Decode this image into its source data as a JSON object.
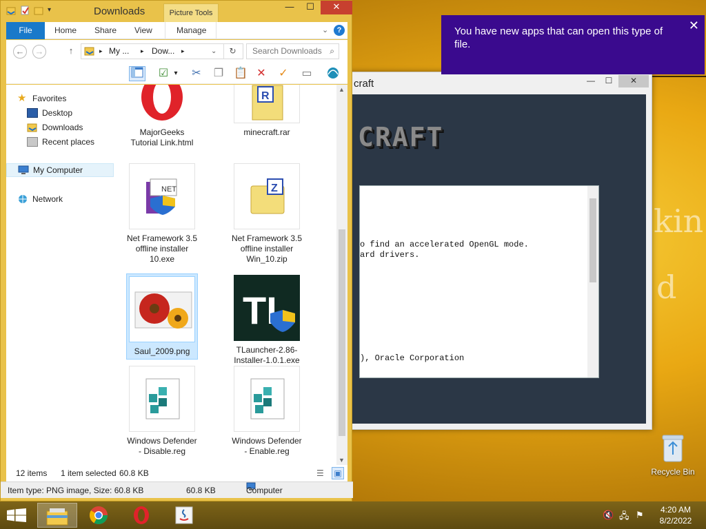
{
  "explorer": {
    "title": "Downloads",
    "picture_tools": "Picture Tools",
    "close_glyph": "✕",
    "minimize_glyph": "—",
    "maximize_glyph": "☐",
    "ribbon": {
      "tabs": [
        "File",
        "Home",
        "Share",
        "View",
        "Manage"
      ],
      "help": "?"
    },
    "address": {
      "parts": [
        "My ...",
        "Dow..."
      ],
      "search_placeholder": "Search Downloads"
    },
    "nav": {
      "favorites": "Favorites",
      "desktop": "Desktop",
      "downloads": "Downloads",
      "recent": "Recent places",
      "computer": "My Computer",
      "network": "Network"
    },
    "files": [
      {
        "name": "MajorGeeks Tutorial Link.html"
      },
      {
        "name": "minecraft.rar"
      },
      {
        "name": "Net Framework 3.5 offline installer 10.exe"
      },
      {
        "name": "Net Framework 3.5 offline installer Win_10.zip"
      },
      {
        "name": "Saul_2009.png"
      },
      {
        "name": "TLauncher-2.86-Installer-1.0.1.exe"
      },
      {
        "name": "Windows Defender - Disable.reg"
      },
      {
        "name": "Windows Defender - Enable.reg"
      }
    ],
    "file_icon_text": {
      "net": "NET",
      "rar_letter": "R",
      "zip_letter": "Z",
      "tl": "TL"
    },
    "status": {
      "items": "12 items",
      "selected": "1 item selected",
      "size": "60.8 KB"
    },
    "details": {
      "item_type": "Item type: PNG image, Size: 60.8 KB",
      "size": "60.8 KB",
      "location": "Computer"
    }
  },
  "minecraft": {
    "title_fragment": "craft",
    "logo_fragment": "CRAFT",
    "log_lines": [
      "o find an accelerated OpenGL mode.",
      "ard drivers.",
      "), Oracle Corporation"
    ]
  },
  "toast": {
    "message": "You have new apps that can open this type of file.",
    "close": "✕"
  },
  "desktop": {
    "recycle_bin": "Recycle Bin",
    "bg_text_1": "kin",
    "bg_text_2": "d"
  },
  "taskbar": {
    "time": "4:20 AM",
    "date": "8/2/2022"
  },
  "colors": {
    "toast_bg": "#3a0a8e",
    "file_tab": "#1979ca",
    "window_frame": "#e9c24a",
    "selection": "#cce8ff"
  }
}
